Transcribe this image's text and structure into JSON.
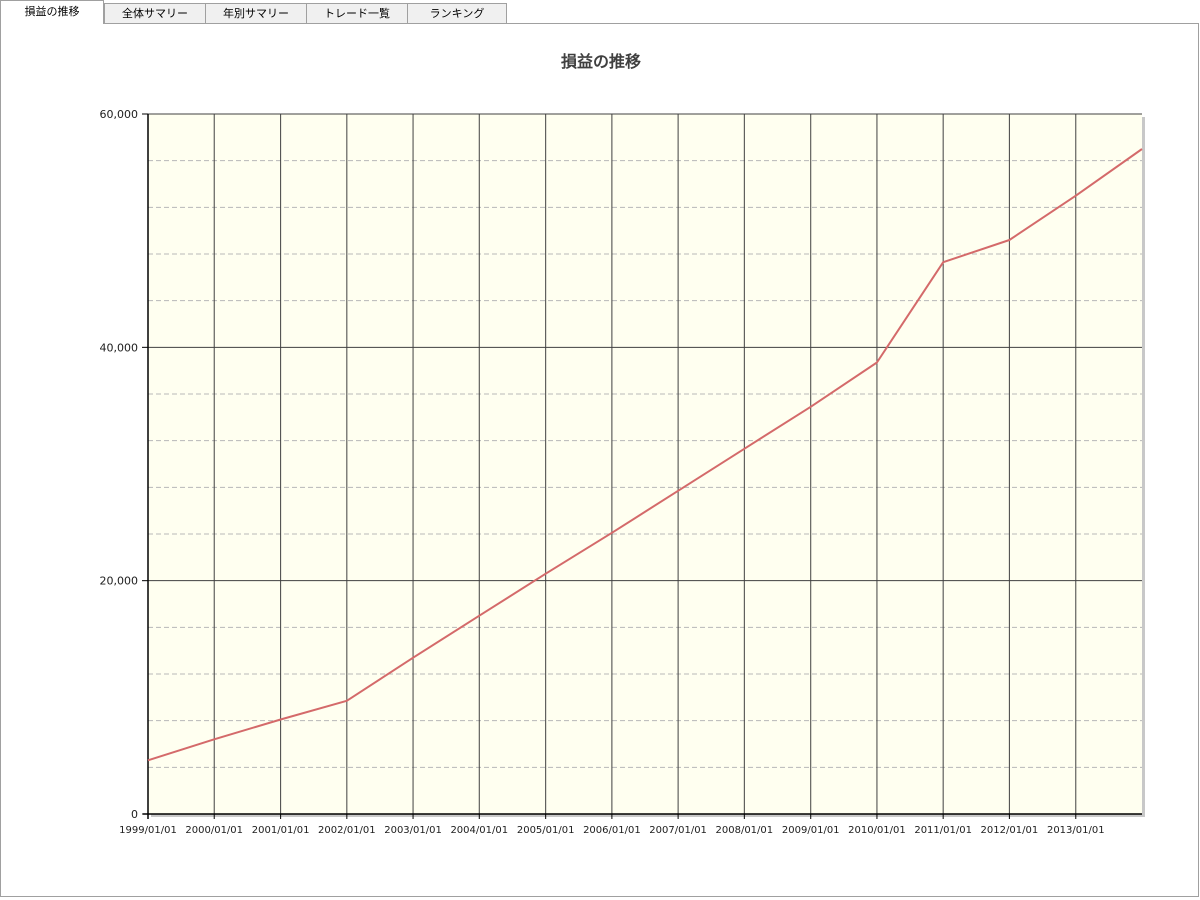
{
  "tabs": [
    {
      "label": "損益の推移",
      "active": true
    },
    {
      "label": "全体サマリー",
      "active": false
    },
    {
      "label": "年別サマリー",
      "active": false
    },
    {
      "label": "トレード一覧",
      "active": false
    },
    {
      "label": "ランキング",
      "active": false
    }
  ],
  "chart_data": {
    "type": "line",
    "title": "損益の推移",
    "xlabel": "",
    "ylabel": "",
    "x_tick_labels": [
      "1999/01/01",
      "2000/01/01",
      "2001/01/01",
      "2002/01/01",
      "2003/01/01",
      "2004/01/01",
      "2005/01/01",
      "2006/01/01",
      "2007/01/01",
      "2008/01/01",
      "2009/01/01",
      "2010/01/01",
      "2011/01/01",
      "2012/01/01",
      "2013/01/01"
    ],
    "y_tick_labels": [
      "0",
      "20,000",
      "40,000",
      "60,000"
    ],
    "xlim": [
      "1999/01/01",
      "2014/01/01"
    ],
    "ylim": [
      0,
      60000
    ],
    "grid": true,
    "colors": {
      "plot_background": "#fffff0",
      "line": "#d46a6a",
      "major_grid": "#404040",
      "minor_grid": "#b8b8b8"
    },
    "series": [
      {
        "x": [
          "1999/01/01",
          "2000/01/01",
          "2001/01/01",
          "2002/01/01",
          "2003/01/01",
          "2004/01/01",
          "2005/01/01",
          "2006/01/01",
          "2007/01/01",
          "2008/01/01",
          "2009/01/01",
          "2010/01/01",
          "2011/01/01",
          "2012/01/01",
          "2013/01/01",
          "2014/01/01"
        ],
        "values": [
          4600,
          6400,
          8100,
          9700,
          13400,
          17000,
          20600,
          24100,
          27700,
          31300,
          34900,
          38700,
          47300,
          49200,
          53000,
          57000
        ]
      }
    ]
  }
}
